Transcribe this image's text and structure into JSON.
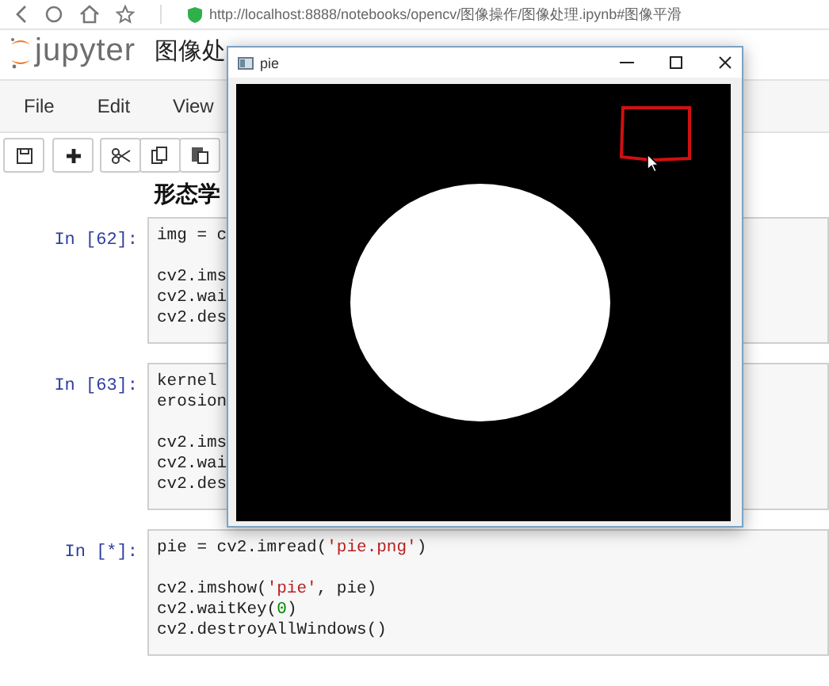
{
  "browser": {
    "url": "http://localhost:8888/notebooks/opencv/图像操作/图像处理.ipynb#图像平滑"
  },
  "notebook": {
    "logo": "jupyter",
    "title": "图像处",
    "menu": [
      "File",
      "Edit",
      "View"
    ],
    "heading": "形态学"
  },
  "cells": [
    {
      "prompt": "In [62]:",
      "lines": [
        {
          "segs": [
            {
              "text": "img = c",
              "kind": "code"
            }
          ]
        },
        {
          "gap": true,
          "segs": [
            {
              "text": "cv2.ims",
              "kind": "code"
            }
          ]
        },
        {
          "segs": [
            {
              "text": "cv2.wai",
              "kind": "code"
            }
          ]
        },
        {
          "segs": [
            {
              "text": "cv2.des",
              "kind": "code"
            }
          ]
        }
      ]
    },
    {
      "prompt": "In [63]:",
      "lines": [
        {
          "segs": [
            {
              "text": "kernel",
              "kind": "code"
            }
          ]
        },
        {
          "segs": [
            {
              "text": "erosion",
              "kind": "code"
            }
          ]
        },
        {
          "gap": true,
          "segs": [
            {
              "text": "cv2.ims",
              "kind": "code"
            }
          ]
        },
        {
          "segs": [
            {
              "text": "cv2.wai",
              "kind": "code"
            }
          ]
        },
        {
          "segs": [
            {
              "text": "cv2.des",
              "kind": "code"
            }
          ]
        }
      ]
    },
    {
      "prompt": "In [*]:",
      "lines": [
        {
          "segs": [
            {
              "text": "pie = cv2.imread(",
              "kind": "code"
            },
            {
              "text": "'pie.png'",
              "kind": "string"
            },
            {
              "text": ")",
              "kind": "code"
            }
          ]
        },
        {
          "gap": true,
          "segs": [
            {
              "text": "cv2.imshow(",
              "kind": "code"
            },
            {
              "text": "'pie'",
              "kind": "string"
            },
            {
              "text": ", pie)",
              "kind": "code"
            }
          ]
        },
        {
          "segs": [
            {
              "text": "cv2.waitKey(",
              "kind": "code"
            },
            {
              "text": "0",
              "kind": "number"
            },
            {
              "text": ")",
              "kind": "code"
            }
          ]
        },
        {
          "segs": [
            {
              "text": "cv2.destroyAllWindows()",
              "kind": "code"
            }
          ]
        }
      ]
    }
  ],
  "window": {
    "title": "pie"
  }
}
